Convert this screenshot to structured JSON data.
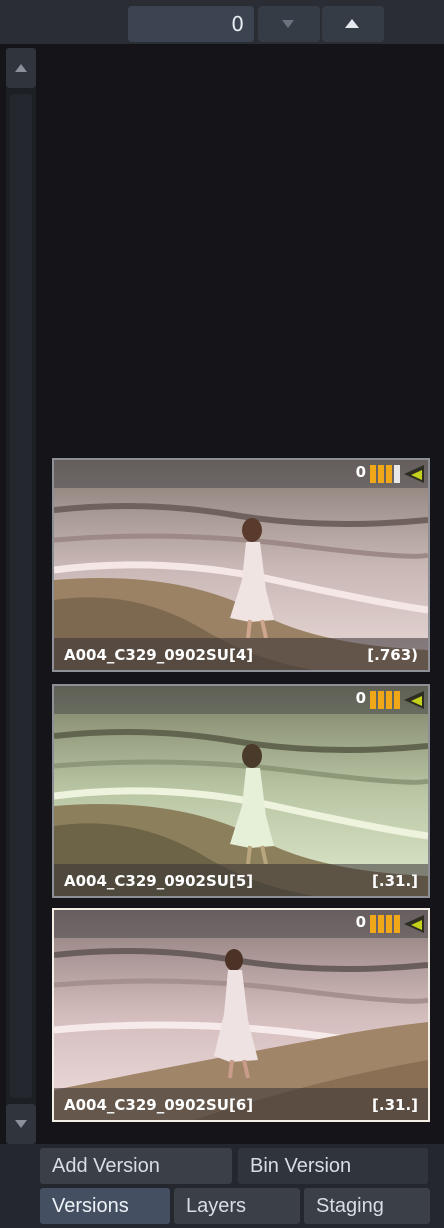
{
  "counter": {
    "value": "0"
  },
  "versions": [
    {
      "name": "A004_C329_0902SU[4]",
      "range": "[.763)",
      "count": "0",
      "meter_filled": 3,
      "meter_total": 4,
      "tint": "warm"
    },
    {
      "name": "A004_C329_0902SU[5]",
      "range": "[.31.]",
      "count": "0",
      "meter_filled": 4,
      "meter_total": 4,
      "tint": "green"
    },
    {
      "name": "A004_C329_0902SU[6]",
      "range": "[.31.]",
      "count": "0",
      "meter_filled": 4,
      "meter_total": 4,
      "tint": "pink",
      "selected": true
    }
  ],
  "actions": {
    "add_version": "Add Version",
    "bin_version": "Bin Version"
  },
  "tabs": {
    "versions": "Versions",
    "layers": "Layers",
    "staging": "Staging",
    "active": "Versions"
  },
  "colors": {
    "meter": "#f0a818",
    "flag": "#c4d21c",
    "active_tab": "#445062"
  }
}
